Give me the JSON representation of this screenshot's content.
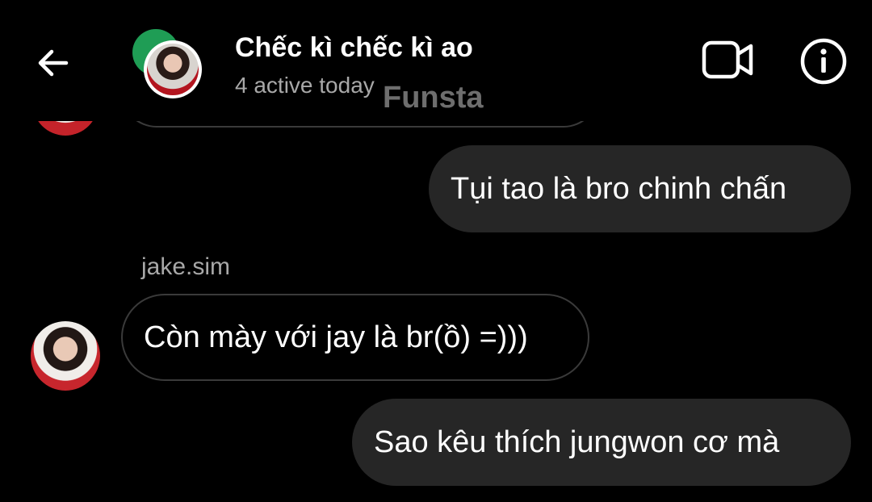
{
  "header": {
    "title": "Chếc kì chếc kì ao",
    "subtitle": "4 active today",
    "watermark": "Funsta",
    "back_icon": "arrow-left-icon",
    "video_icon": "video-camera-icon",
    "info_icon": "info-icon"
  },
  "messages": [
    {
      "direction": "outgoing",
      "text": "Tụi tao là bro chinh chấn"
    },
    {
      "direction": "incoming",
      "sender": "jake.sim",
      "text": "Còn mày với jay là br(ồ) =)))"
    },
    {
      "direction": "outgoing",
      "text": "Sao kêu thích jungwon cơ mà"
    }
  ],
  "colors": {
    "background": "#000000",
    "outgoing_bubble": "#262626",
    "incoming_border": "#3a3a3a",
    "secondary_text": "#a8a8a8",
    "group_avatar_accent": "#1f9d55"
  }
}
